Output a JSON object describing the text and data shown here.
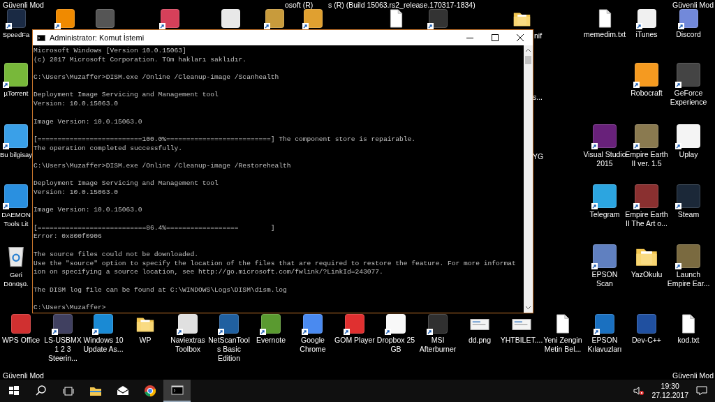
{
  "desktop": {
    "mode_labels": [
      "Güvenli Mod",
      "Güvenli Mod",
      "Güvenli Mod",
      "Güvenli Mod"
    ],
    "build_text_fragments": [
      "osoft (R)",
      "s (R) (Build 15063.rs2_release.170317-1834)"
    ],
    "top_row": [
      {
        "kind": "app",
        "color": "#1a2a44",
        "shortcut": true,
        "label": "SpeedFa"
      },
      {
        "kind": "app",
        "color": "#f08a00",
        "shortcut": true
      },
      {
        "kind": "app",
        "color": "#555555",
        "shortcut": false
      },
      {
        "kind": "app",
        "color": "#d6405a",
        "shortcut": true
      },
      {
        "kind": "app",
        "color": "#e8e8e8",
        "shortcut": false
      },
      {
        "kind": "app",
        "color": "#c89b3c",
        "shortcut": true
      },
      {
        "kind": "app",
        "color": "#e0a030",
        "shortcut": true
      },
      {
        "kind": "document",
        "shortcut": false
      },
      {
        "kind": "app",
        "color": "#333333",
        "shortcut": true
      },
      {
        "kind": "folder",
        "shortcut": false
      },
      {
        "kind": "document",
        "shortcut": false,
        "label": "memedim.txt"
      },
      {
        "kind": "app",
        "color": "#f0f0f0",
        "shortcut": true,
        "label": "iTunes"
      },
      {
        "kind": "app",
        "color": "#7289da",
        "shortcut": true,
        "label": "Discord"
      }
    ],
    "left_column": [
      {
        "kind": "app",
        "color": "#78b83a",
        "shortcut": true,
        "label": "µTorrent"
      },
      {
        "kind": "app",
        "color": "#3aa0e8",
        "shortcut": true,
        "label": "Bu bilgisay"
      },
      {
        "kind": "app",
        "color": "#2a90e0",
        "shortcut": true,
        "label": "DAEMON Tools Lit"
      },
      {
        "kind": "trash",
        "shortcut": false,
        "label": "Geri Dönüşü."
      }
    ],
    "right_grid": [
      {
        "kind": "app",
        "color": "#f59a20",
        "shortcut": true,
        "label": "Robocraft"
      },
      {
        "kind": "app",
        "color": "#444444",
        "shortcut": true,
        "label": "GeForce Experience"
      },
      {
        "kind": "app",
        "color": "#68217a",
        "shortcut": true,
        "label": "Visual Studio 2015"
      },
      {
        "kind": "app",
        "color": "#8a7a50",
        "shortcut": true,
        "label": "Empire Earth II ver. 1.5"
      },
      {
        "kind": "app",
        "color": "#f4f4f4",
        "shortcut": true,
        "label": "Uplay"
      },
      {
        "kind": "app",
        "color": "#2ca5e0",
        "shortcut": true,
        "label": "Telegram"
      },
      {
        "kind": "app",
        "color": "#8a3030",
        "shortcut": true,
        "label": "Empire Earth II The Art o..."
      },
      {
        "kind": "app",
        "color": "#1b2838",
        "shortcut": true,
        "label": "Steam"
      },
      {
        "kind": "app",
        "color": "#6080c0",
        "shortcut": true,
        "label": "EPSON Scan"
      },
      {
        "kind": "folder",
        "shortcut": false,
        "label": "YazOkulu"
      },
      {
        "kind": "app",
        "color": "#7a6a40",
        "shortcut": true,
        "label": "Launch Empire Ear..."
      }
    ],
    "bottom_row": [
      {
        "kind": "app",
        "color": "#d03030",
        "shortcut": false,
        "label": "WPS Office"
      },
      {
        "kind": "app",
        "color": "#404060",
        "shortcut": true,
        "label": "LS-USBMX 1 2 3 Steerin..."
      },
      {
        "kind": "app",
        "color": "#1a8ad4",
        "shortcut": true,
        "label": "Windows 10 Update As..."
      },
      {
        "kind": "folder",
        "shortcut": false,
        "label": "WP"
      },
      {
        "kind": "app",
        "color": "#e0e0e0",
        "shortcut": true,
        "label": "Naviextras Toolbox"
      },
      {
        "kind": "app",
        "color": "#2060a0",
        "shortcut": true,
        "label": "NetScanTools Basic Edition"
      },
      {
        "kind": "app",
        "color": "#5a9a30",
        "shortcut": true,
        "label": "Evernote"
      },
      {
        "kind": "app",
        "color": "#4a8af0",
        "shortcut": true,
        "label": "Google Chrome"
      },
      {
        "kind": "app",
        "color": "#e03030",
        "shortcut": true,
        "label": "GOM Player"
      },
      {
        "kind": "app",
        "color": "#f8f8f8",
        "shortcut": true,
        "label": "Dropbox 25 GB"
      },
      {
        "kind": "app",
        "color": "#303030",
        "shortcut": true,
        "label": "MSI Afterburner"
      },
      {
        "kind": "image",
        "shortcut": false,
        "label": "dd.png"
      },
      {
        "kind": "image",
        "shortcut": false,
        "label": "YHTBILET...."
      },
      {
        "kind": "document",
        "shortcut": false,
        "label": "Yeni Zengin Metin Bel..."
      },
      {
        "kind": "app",
        "color": "#1a70c0",
        "shortcut": true,
        "label": "EPSON Kılavuzları"
      },
      {
        "kind": "app",
        "color": "#2050a0",
        "shortcut": false,
        "label": "Dev-C++"
      },
      {
        "kind": "document",
        "shortcut": false,
        "label": "kod.txt"
      }
    ],
    "hidden_label_fragments": [
      "nif",
      "s...",
      "YG"
    ]
  },
  "window": {
    "title": "Administrator: Komut İstemi",
    "console": [
      {
        "lines": [
          "Microsoft Windows [Version 10.0.15063]",
          "(c) 2017 Microsoft Corporation. Tüm hakları saklıdır."
        ]
      },
      {
        "lines": [
          "C:\\Users\\Muzaffer>DISM.exe /Online /Cleanup-image /Scanhealth"
        ]
      },
      {
        "lines": [
          "Deployment Image Servicing and Management tool",
          "Version: 10.0.15063.0"
        ]
      },
      {
        "lines": [
          "Image Version: 10.0.15063.0"
        ]
      },
      {
        "lines": [
          "[==========================100.0%==========================] The component store is repairable.",
          "The operation completed successfully."
        ]
      },
      {
        "lines": [
          "C:\\Users\\Muzaffer>DISM.exe /Online /Cleanup-image /Restorehealth"
        ]
      },
      {
        "lines": [
          "Deployment Image Servicing and Management tool",
          "Version: 10.0.15063.0"
        ]
      },
      {
        "lines": [
          "Image Version: 10.0.15063.0"
        ]
      },
      {
        "lines": [
          "[===========================86.4%==================        ]",
          "Error: 0x800f0906"
        ]
      },
      {
        "lines": [
          "The source files could not be downloaded.",
          "Use the \"source\" option to specify the location of the files that are required to restore the feature. For more informat",
          "ion on specifying a source location, see http://go.microsoft.com/fwlink/?LinkId=243077."
        ]
      },
      {
        "lines": [
          "The DISM log file can be found at C:\\WINDOWS\\Logs\\DISM\\dism.log"
        ]
      },
      {
        "lines": [
          "C:\\Users\\Muzaffer>"
        ]
      }
    ]
  },
  "taskbar": {
    "pinned": [
      {
        "kind": "start",
        "selected": false
      },
      {
        "kind": "search",
        "selected": false
      },
      {
        "kind": "task-view",
        "selected": false
      },
      {
        "kind": "file-explorer",
        "selected": false
      },
      {
        "kind": "mail",
        "selected": false
      },
      {
        "kind": "browser",
        "selected": false
      },
      {
        "kind": "terminal",
        "selected": true
      }
    ],
    "volume": {
      "muted": true
    },
    "clock": {
      "time": "19:30",
      "date": "27.12.2017"
    }
  }
}
